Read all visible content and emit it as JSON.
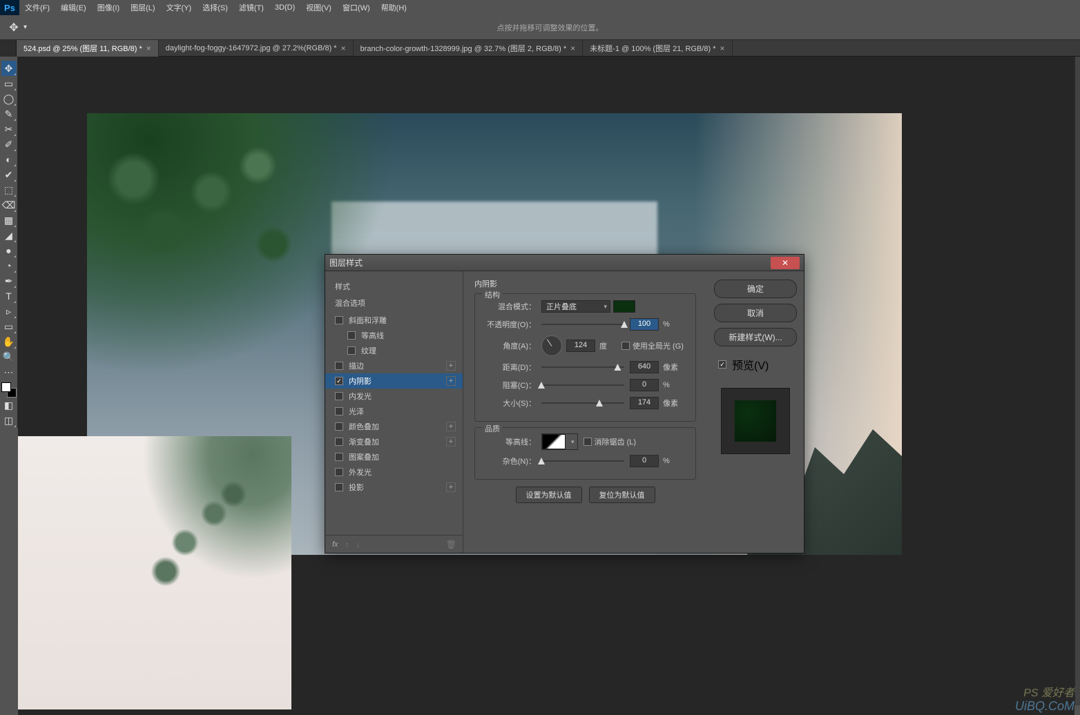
{
  "menubar": {
    "items": [
      "文件(F)",
      "编辑(E)",
      "图像(I)",
      "图层(L)",
      "文字(Y)",
      "选择(S)",
      "滤镜(T)",
      "3D(D)",
      "视图(V)",
      "窗口(W)",
      "帮助(H)"
    ]
  },
  "optionsbar": {
    "hint": "点按并拖移可调整效果的位置。"
  },
  "tabs": [
    {
      "label": "524.psd @ 25% (图层 11, RGB/8) *",
      "active": true
    },
    {
      "label": "daylight-fog-foggy-1647972.jpg @ 27.2%(RGB/8) *",
      "active": false
    },
    {
      "label": "branch-color-growth-1328999.jpg @ 32.7% (图层 2, RGB/8) *",
      "active": false
    },
    {
      "label": "未标题-1 @ 100% (图层 21, RGB/8) *",
      "active": false
    }
  ],
  "toolbar_icons": [
    "✥",
    "▭",
    "◯",
    "✎",
    "✂",
    "✐",
    "◐",
    "✔",
    "⬚",
    "⌫",
    "▩",
    "◢",
    "✒",
    "T",
    "▹",
    "✋",
    "⊕",
    "🔍",
    "⋯",
    "◧",
    "▭",
    "◫"
  ],
  "dialog": {
    "title": "图层样式",
    "styles_header": "样式",
    "blending_label": "混合选项",
    "styles": [
      {
        "label": "斜面和浮雕",
        "checked": false,
        "plus": false,
        "indent": false
      },
      {
        "label": "等高线",
        "checked": false,
        "plus": false,
        "indent": true
      },
      {
        "label": "纹理",
        "checked": false,
        "plus": false,
        "indent": true
      },
      {
        "label": "描边",
        "checked": false,
        "plus": true,
        "indent": false
      },
      {
        "label": "内阴影",
        "checked": true,
        "plus": true,
        "indent": false,
        "selected": true
      },
      {
        "label": "内发光",
        "checked": false,
        "plus": false,
        "indent": false
      },
      {
        "label": "光泽",
        "checked": false,
        "plus": false,
        "indent": false
      },
      {
        "label": "颜色叠加",
        "checked": false,
        "plus": true,
        "indent": false
      },
      {
        "label": "渐变叠加",
        "checked": false,
        "plus": true,
        "indent": false
      },
      {
        "label": "图案叠加",
        "checked": false,
        "plus": false,
        "indent": false
      },
      {
        "label": "外发光",
        "checked": false,
        "plus": false,
        "indent": false
      },
      {
        "label": "投影",
        "checked": false,
        "plus": true,
        "indent": false
      }
    ],
    "fx_label": "fx",
    "section_title": "内阴影",
    "structure_label": "结构",
    "blend_mode_label": "混合模式：",
    "blend_mode_value": "正片叠底",
    "shadow_color": "#0a3010",
    "opacity_label": "不透明度(O)：",
    "opacity_value": "100",
    "percent": "%",
    "angle_label": "角度(A)：",
    "angle_value": "124",
    "angle_unit": "度",
    "global_light_label": "使用全局光 (G)",
    "distance_label": "距离(D)：",
    "distance_value": "640",
    "px": "像素",
    "choke_label": "阻塞(C)：",
    "choke_value": "0",
    "size_label": "大小(S)：",
    "size_value": "174",
    "quality_label": "品质",
    "contour_label": "等高线：",
    "antialias_label": "消除锯齿 (L)",
    "noise_label": "杂色(N)：",
    "noise_value": "0",
    "make_default": "设置为默认值",
    "reset_default": "复位为默认值",
    "buttons": {
      "ok": "确定",
      "cancel": "取消",
      "new_style": "新建样式(W)...",
      "preview": "预览(V)"
    }
  },
  "watermark1": "PS 爱好者",
  "watermark2": "UiBQ.CoM"
}
